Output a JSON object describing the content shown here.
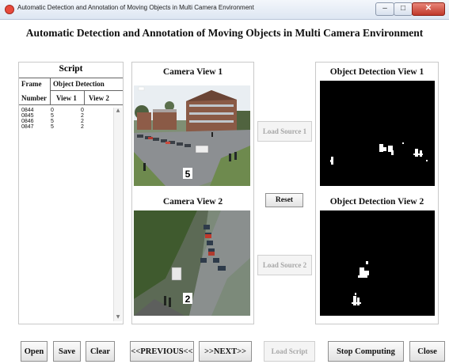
{
  "window": {
    "title": "Automatic Detection and Annotation of Moving Objects in Multi Camera Environment",
    "min_symbol": "–",
    "max_symbol": "□",
    "close_symbol": "✕"
  },
  "app": {
    "heading": "Automatic Detection and Annotation of Moving Objects in Multi Camera Environment"
  },
  "script": {
    "title": "Script",
    "header_frame": "Frame",
    "header_number": "Number",
    "header_object_detection": "Object Detection",
    "header_view1": "View 1",
    "header_view2": "View 2",
    "rows": [
      {
        "frame": "0844",
        "view1": "0",
        "view2": "0"
      },
      {
        "frame": "0845",
        "view1": "5",
        "view2": "2"
      },
      {
        "frame": "0846",
        "view1": "5",
        "view2": "2"
      },
      {
        "frame": "0847",
        "view1": "5",
        "view2": "2"
      }
    ]
  },
  "cameras": {
    "view1_title": "Camera View 1",
    "view1_count": "5",
    "view2_title": "Camera View 2",
    "view2_count": "2"
  },
  "sources": {
    "load_source_1": "Load Source 1",
    "reset": "Reset",
    "load_source_2": "Load Source 2"
  },
  "detections": {
    "view1_title": "Object Detection View 1",
    "view2_title": "Object Detection View 2"
  },
  "toolbar": {
    "open": "Open",
    "save": "Save",
    "clear": "Clear",
    "previous": "<<PREVIOUS<<",
    "next": ">>NEXT>>",
    "load_script": "Load Script",
    "stop_computing": "Stop Computing",
    "close": "Close"
  }
}
